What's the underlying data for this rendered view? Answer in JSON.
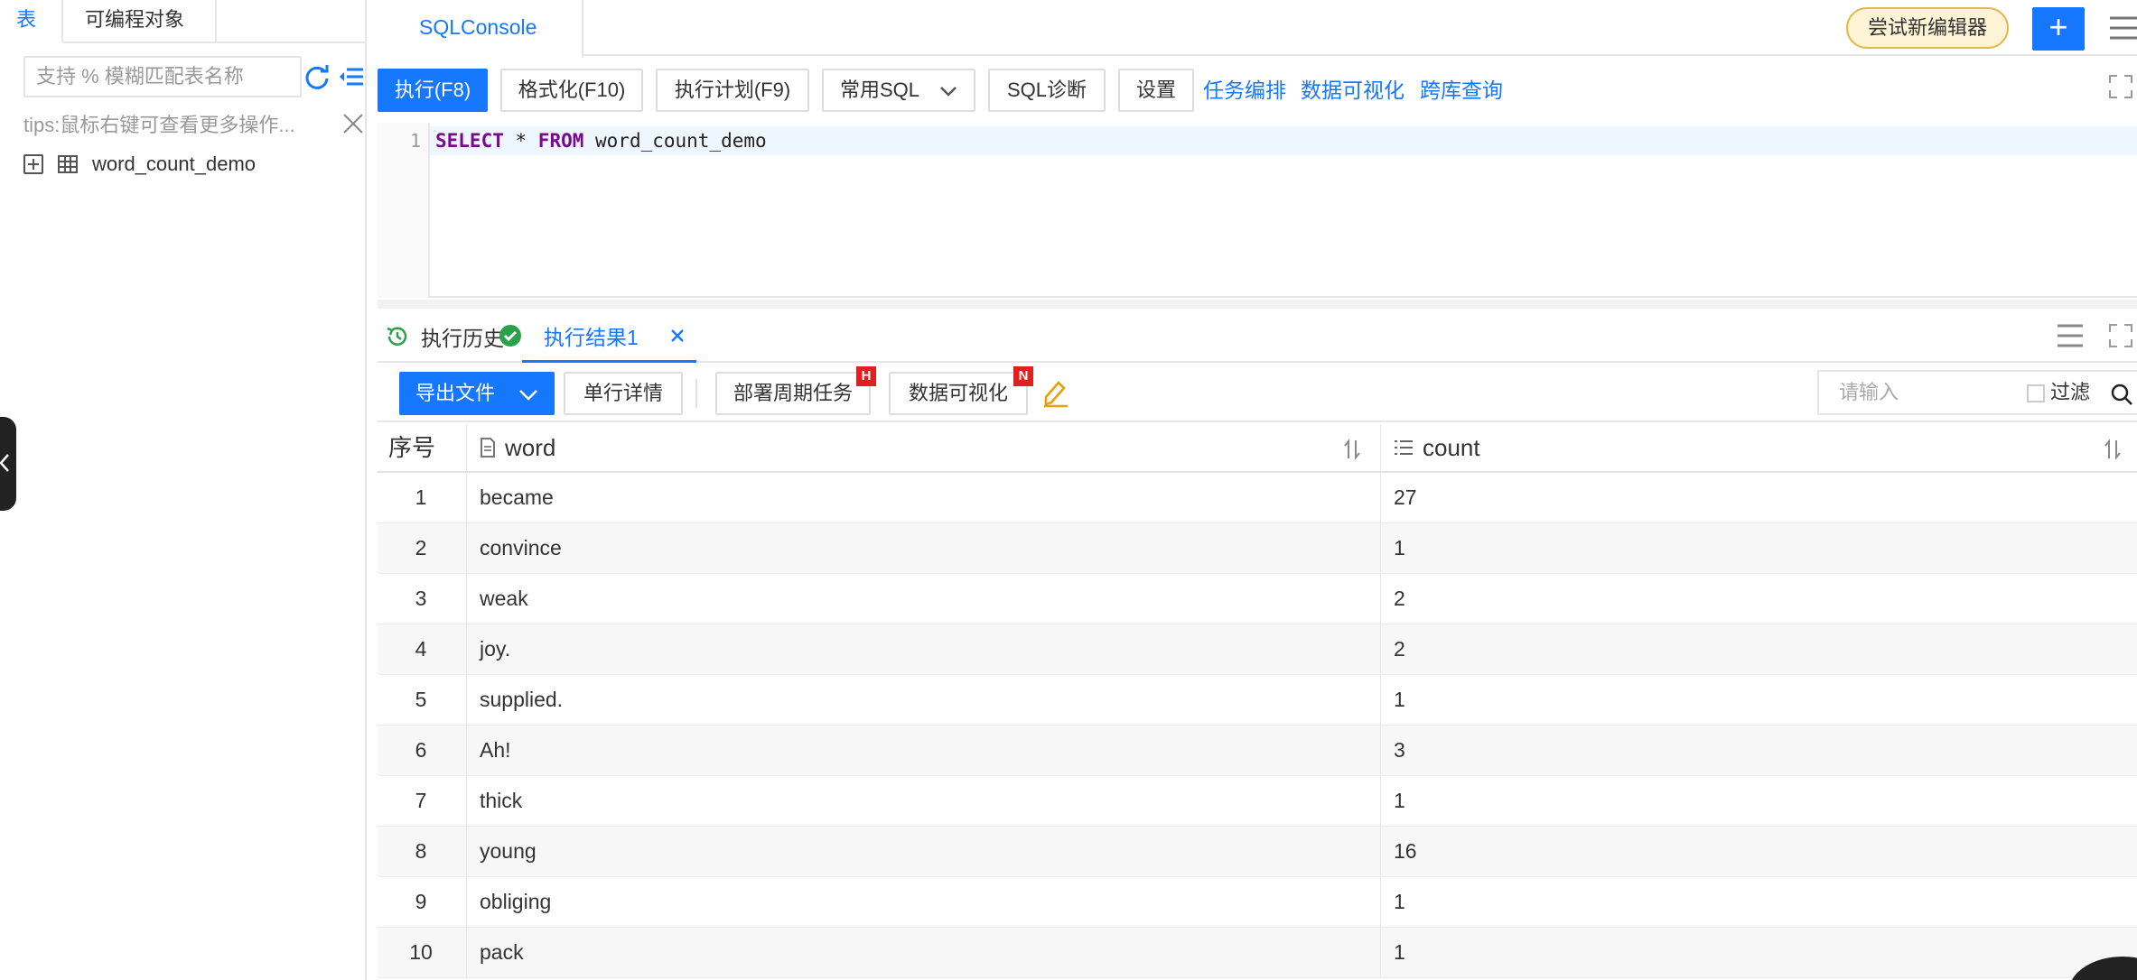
{
  "left_panel": {
    "tabs": [
      "表",
      "可编程对象"
    ],
    "search_placeholder": "支持 % 模糊匹配表名称",
    "tips": "tips:鼠标右键可查看更多操作...",
    "tables": [
      "word_count_demo"
    ]
  },
  "topbar": {
    "console_tab": "SQLConsole",
    "try_new_editor": "尝试新编辑器",
    "add_label": "+"
  },
  "toolbar": {
    "execute": "执行(F8)",
    "format": "格式化(F10)",
    "plan": "执行计划(F9)",
    "common_sql": "常用SQL",
    "diagnose": "SQL诊断",
    "settings": "设置",
    "link_tasks": "任务编排",
    "link_visual": "数据可视化",
    "link_cross": "跨库查询"
  },
  "editor": {
    "line_number": "1",
    "kw_select": "SELECT",
    "star": " * ",
    "kw_from": "FROM",
    "table": " word_count_demo"
  },
  "result_tabs": {
    "history": "执行历史",
    "result": "执行结果1"
  },
  "result_toolbar": {
    "export": "导出文件",
    "row_detail": "单行详情",
    "deploy_task": "部署周期任务",
    "deploy_badge": "H",
    "visualize": "数据可视化",
    "visualize_badge": "N",
    "filter_placeholder": "请输入",
    "filter_label": "过滤"
  },
  "table": {
    "headers": {
      "index": "序号",
      "word": "word",
      "count": "count"
    },
    "rows": [
      {
        "idx": "1",
        "word": "became",
        "count": "27"
      },
      {
        "idx": "2",
        "word": "convince",
        "count": "1"
      },
      {
        "idx": "3",
        "word": "weak",
        "count": "2"
      },
      {
        "idx": "4",
        "word": "joy.",
        "count": "2"
      },
      {
        "idx": "5",
        "word": "supplied.",
        "count": "1"
      },
      {
        "idx": "6",
        "word": "Ah!",
        "count": "3"
      },
      {
        "idx": "7",
        "word": "thick",
        "count": "1"
      },
      {
        "idx": "8",
        "word": "young",
        "count": "16"
      },
      {
        "idx": "9",
        "word": "obliging",
        "count": "1"
      },
      {
        "idx": "10",
        "word": "pack",
        "count": "1"
      }
    ]
  },
  "colors": {
    "accent": "#1677ff",
    "badge": "#e02020",
    "try_bg": "#fff4d6",
    "success": "#2aa14a"
  }
}
